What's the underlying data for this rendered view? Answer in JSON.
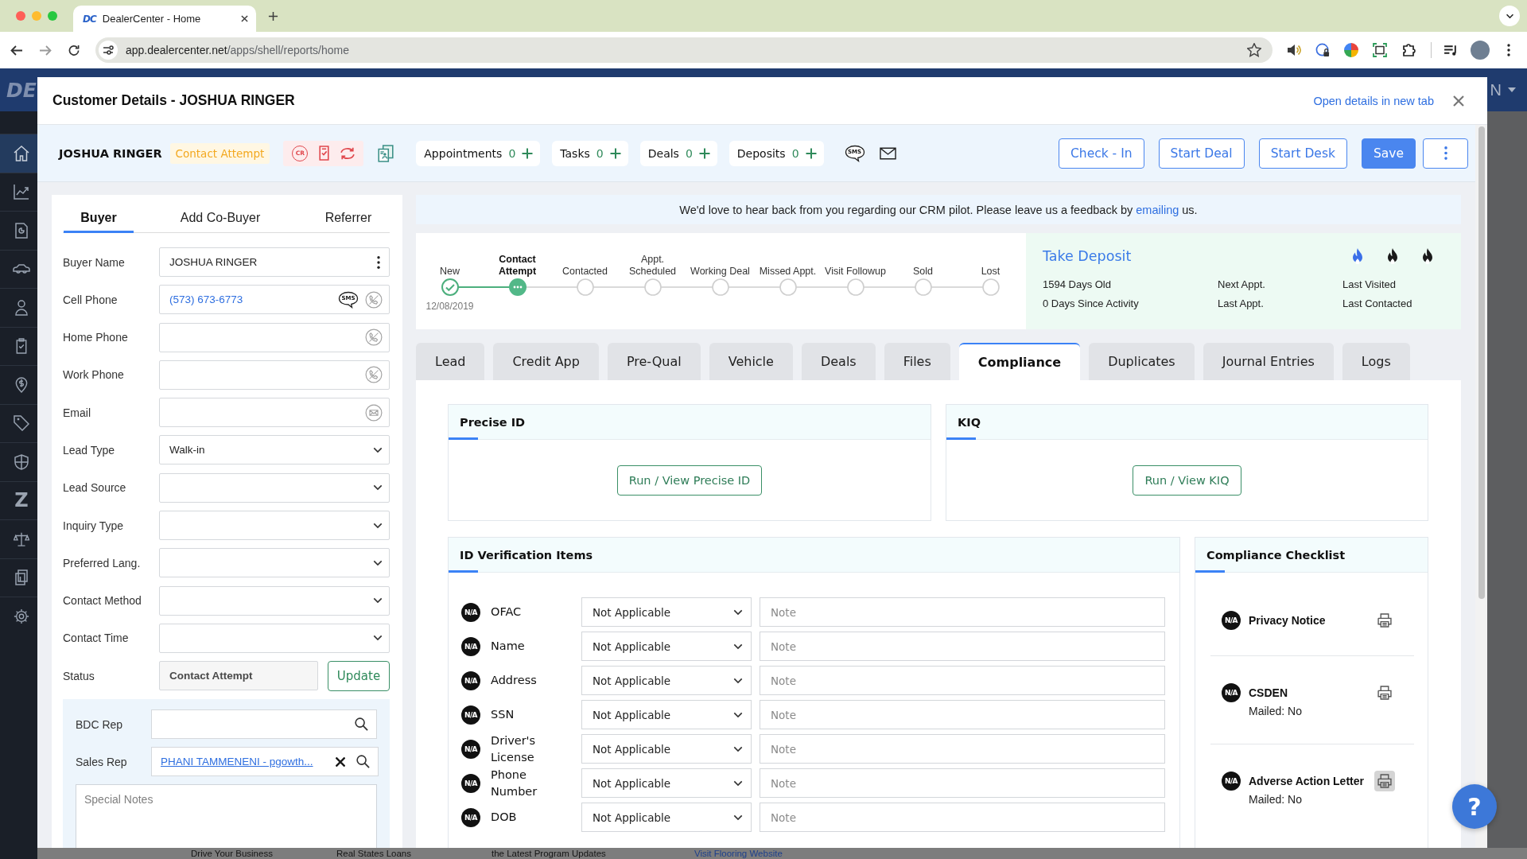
{
  "browser": {
    "tab": {
      "favicon": "DC",
      "title": "DealerCenter - Home"
    },
    "url": {
      "host": "app.dealercenter.net",
      "path": "/apps/shell/reports/home"
    }
  },
  "background_app": {
    "logo": "DE",
    "user_menu": "N",
    "sidebar": [
      {
        "kind": "home",
        "selected": true
      },
      {
        "kind": "chart",
        "selected": false
      },
      {
        "kind": "report",
        "selected": false
      },
      {
        "kind": "car",
        "selected": false
      },
      {
        "kind": "person",
        "selected": false
      },
      {
        "kind": "checklist",
        "selected": false
      },
      {
        "kind": "money-pin",
        "selected": false
      },
      {
        "kind": "tag",
        "selected": false
      },
      {
        "kind": "shield",
        "selected": false
      },
      {
        "kind": "letter",
        "glyph": "Z",
        "selected": false
      },
      {
        "kind": "scales",
        "selected": false
      },
      {
        "kind": "bills",
        "selected": false
      },
      {
        "kind": "gear",
        "selected": false
      }
    ],
    "footer_texts": [
      {
        "text": "Drive Your Business",
        "kind": "plain"
      },
      {
        "text": "Real States Loans",
        "kind": "plain"
      },
      {
        "text": "the Latest Program Updates",
        "kind": "plain"
      },
      {
        "text": "Visit Flooring Website",
        "kind": "link"
      }
    ]
  },
  "modal": {
    "title": "Customer Details - JOSHUA RINGER",
    "open_link": "Open details in new tab"
  },
  "customer_bar": {
    "name": "JOSHUA RINGER",
    "status": "Contact Attempt",
    "quick_actions": [
      {
        "kind": "text",
        "label": "CR"
      },
      {
        "kind": "checklist"
      },
      {
        "kind": "exchange"
      }
    ],
    "counters": [
      {
        "label": "Appointments",
        "count": "0"
      },
      {
        "label": "Tasks",
        "count": "0"
      },
      {
        "label": "Deals",
        "count": "0"
      },
      {
        "label": "Deposits",
        "count": "0"
      }
    ],
    "sms": "SMS",
    "buttons": [
      {
        "label": "Check - In",
        "kind": "outline"
      },
      {
        "label": "Start Deal",
        "kind": "outline"
      },
      {
        "label": "Start Desk",
        "kind": "outline"
      },
      {
        "label": "Save",
        "kind": "primary"
      }
    ]
  },
  "buyer_panel": {
    "tabs": [
      {
        "label": "Buyer",
        "selected": true
      },
      {
        "label": "Add Co-Buyer",
        "selected": false
      },
      {
        "label": "Referrer",
        "selected": false
      }
    ],
    "fields": [
      {
        "label": "Buyer Name",
        "kind": "text",
        "value": "JOSHUA RINGER"
      },
      {
        "label": "Cell Phone",
        "kind": "phone",
        "value": "(573) 673-6773",
        "sms": "SMS"
      },
      {
        "label": "Home Phone",
        "kind": "phone"
      },
      {
        "label": "Work Phone",
        "kind": "phone"
      },
      {
        "label": "Email",
        "kind": "email"
      },
      {
        "label": "Lead Type",
        "kind": "select",
        "value": "Walk-in"
      },
      {
        "label": "Lead Source",
        "kind": "select"
      },
      {
        "label": "Inquiry Type",
        "kind": "select"
      },
      {
        "label": "Preferred Lang.",
        "kind": "select"
      },
      {
        "label": "Contact Method",
        "kind": "select"
      },
      {
        "label": "Contact Time",
        "kind": "select"
      },
      {
        "label": "Status",
        "kind": "status",
        "value": "Contact Attempt",
        "button": "Update"
      }
    ],
    "reps": [
      {
        "label": "BDC Rep"
      },
      {
        "label": "Sales Rep",
        "value": "PHANI TAMMENENI - pgowth..."
      }
    ],
    "notes": {
      "placeholder": "Special Notes"
    }
  },
  "feedback": {
    "before": "We'd love to hear back from you regarding our CRM pilot. Please leave us a feedback by",
    "link": "emailing",
    "after": "us."
  },
  "pipeline": {
    "stages": [
      {
        "label": "New",
        "completed": true,
        "selected": false,
        "date": "12/08/2019"
      },
      {
        "label": "Contact Attempt",
        "completed": false,
        "selected": true
      },
      {
        "label": "Contacted",
        "completed": false,
        "selected": false
      },
      {
        "label": "Appt. Scheduled",
        "completed": false,
        "selected": false
      },
      {
        "label": "Working Deal",
        "completed": false,
        "selected": false
      },
      {
        "label": "Missed Appt.",
        "completed": false,
        "selected": false
      },
      {
        "label": "Visit Followup",
        "completed": false,
        "selected": false
      },
      {
        "label": "Sold",
        "completed": false,
        "selected": false
      },
      {
        "label": "Lost",
        "completed": false,
        "selected": false
      }
    ]
  },
  "deposit": {
    "title": "Take Deposit",
    "flames": [
      {
        "selected": true
      },
      {
        "selected": false
      },
      {
        "selected": false
      }
    ],
    "info_columns": [
      [
        "1594 Days Old",
        "0 Days Since Activity"
      ],
      [
        "Next Appt.",
        "Last Appt."
      ],
      [
        "Last Visited",
        "Last Contacted"
      ]
    ]
  },
  "record_tabs": [
    {
      "label": "Lead",
      "selected": false
    },
    {
      "label": "Credit App",
      "selected": false
    },
    {
      "label": "Pre-Qual",
      "selected": false
    },
    {
      "label": "Vehicle",
      "selected": false
    },
    {
      "label": "Deals",
      "selected": false
    },
    {
      "label": "Files",
      "selected": false
    },
    {
      "label": "Compliance",
      "selected": true
    },
    {
      "label": "Duplicates",
      "selected": false
    },
    {
      "label": "Journal Entries",
      "selected": false
    },
    {
      "label": "Logs",
      "selected": false
    }
  ],
  "compliance": {
    "lookup_cards": [
      {
        "title": "Precise ID",
        "button": "Run / View Precise ID"
      },
      {
        "title": "KIQ",
        "button": "Run / View KIQ"
      }
    ],
    "id_verification": {
      "title": "ID Verification Items",
      "items": [
        {
          "status": "N/A",
          "label": "OFAC",
          "value": "Not Applicable",
          "note": {
            "placeholder": "Note"
          }
        },
        {
          "status": "N/A",
          "label": "Name",
          "value": "Not Applicable",
          "note": {
            "placeholder": "Note"
          }
        },
        {
          "status": "N/A",
          "label": "Address",
          "value": "Not Applicable",
          "note": {
            "placeholder": "Note"
          }
        },
        {
          "status": "N/A",
          "label": "SSN",
          "value": "Not Applicable",
          "note": {
            "placeholder": "Note"
          }
        },
        {
          "status": "N/A",
          "label": "Driver's License",
          "value": "Not Applicable",
          "note": {
            "placeholder": "Note"
          }
        },
        {
          "status": "N/A",
          "label": "Phone Number",
          "value": "Not Applicable",
          "note": {
            "placeholder": "Note"
          }
        },
        {
          "status": "N/A",
          "label": "DOB",
          "value": "Not Applicable",
          "note": {
            "placeholder": "Note"
          }
        }
      ]
    },
    "checklist": {
      "title": "Compliance Checklist",
      "items": [
        {
          "status": "N/A",
          "title": "Privacy Notice",
          "hovered": false
        },
        {
          "status": "N/A",
          "title": "CSDEN",
          "detail": "Mailed: No",
          "hovered": false
        },
        {
          "status": "N/A",
          "title": "Adverse Action Letter",
          "detail": "Mailed: No",
          "hovered": true
        }
      ]
    }
  },
  "help_button": "?"
}
